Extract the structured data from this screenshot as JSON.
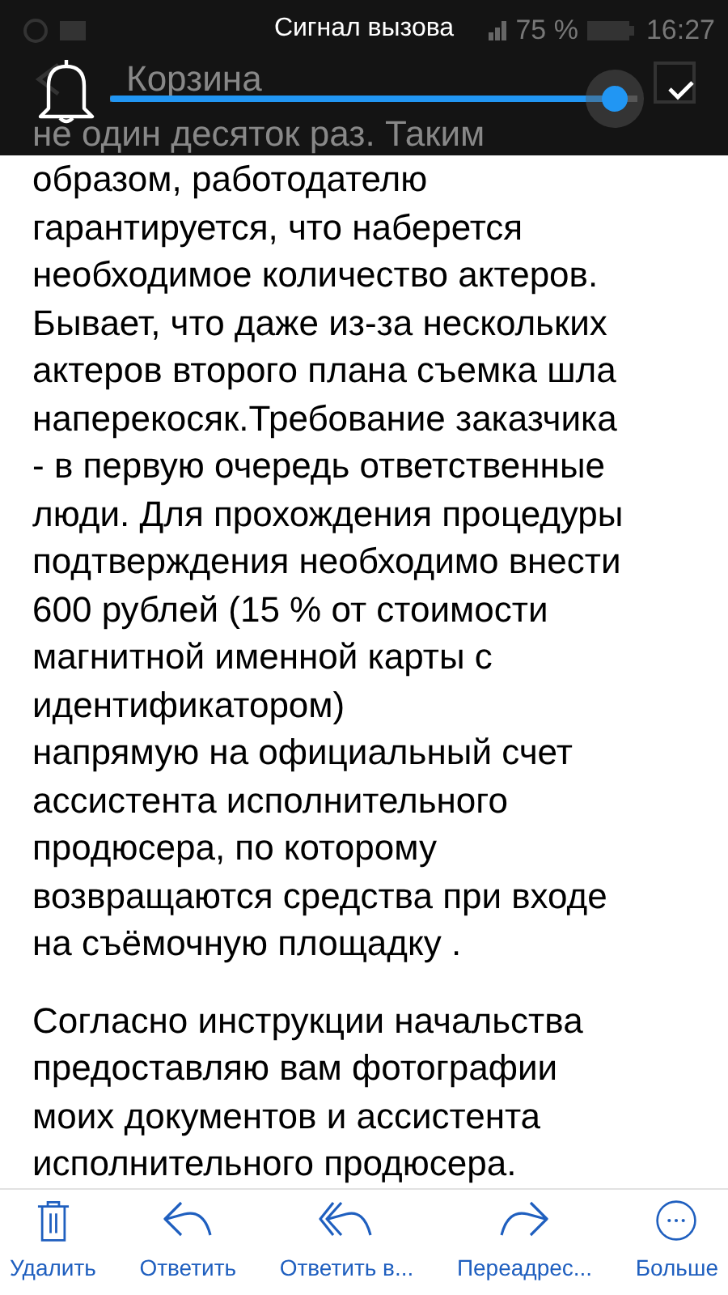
{
  "status_bar": {
    "battery": "75 %",
    "time": "16:27"
  },
  "header": {
    "title": "Корзина"
  },
  "volume_popup": {
    "title": "Сигнал вызова",
    "level": 0.96
  },
  "message": {
    "covered_line": "не один десяток раз. Таким",
    "paragraphs": [
      "образом, работодателю\nгарантируется, что наберется\nнеобходимое количество актеров.\nБывает, что даже из-за нескольких\nактеров второго плана съемка шла\nнаперекосяк.Требование заказчика\n- в первую очередь ответственные\nлюди. Для прохождения процедуры\nподтверждения необходимо внести\n600 рублей (15 % от стоимости\nмагнитной именной карты с\nидентификатором)\nнапрямую на официальный счет\nассистента исполнительного\nпродюсера, по которому\nвозвращаются средства при входе\nна съёмочную площадку .",
      "Согласно инструкции начальства\nпредоставляю вам фотографии\nмоих документов и ассистента\nисполнительного продюсера."
    ]
  },
  "toolbar": [
    {
      "kind": "delete",
      "label": "Удалить"
    },
    {
      "kind": "reply",
      "label": "Ответить"
    },
    {
      "kind": "reply_all",
      "label": "Ответить в..."
    },
    {
      "kind": "forward",
      "label": "Переадрес..."
    },
    {
      "kind": "more",
      "label": "Больше"
    }
  ]
}
